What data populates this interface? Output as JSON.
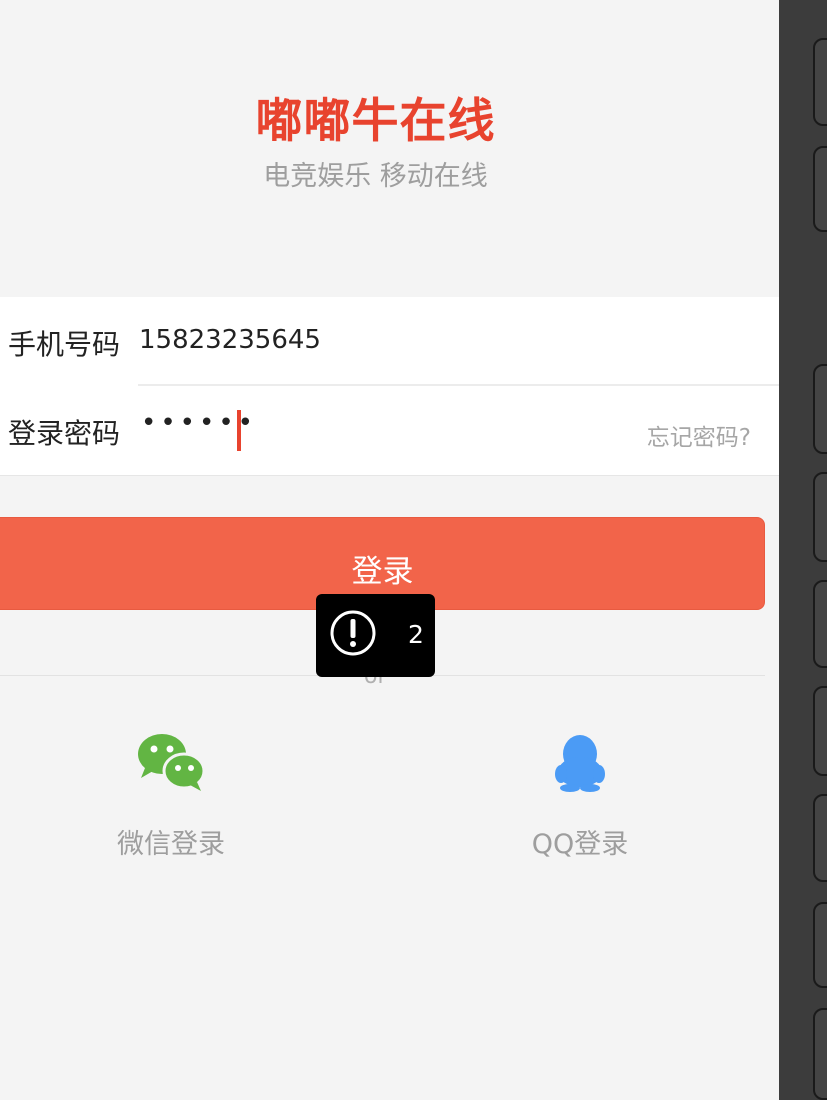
{
  "header": {
    "app_title": "嘟嘟牛在线",
    "tagline": "电竞娱乐 移动在线"
  },
  "form": {
    "phone_label": "手机号码",
    "phone_value": "15823235645",
    "password_label": "登录密码",
    "password_masked": "••••••",
    "forgot_label": "忘记密码?"
  },
  "actions": {
    "login_label": "登录",
    "or_text": "or"
  },
  "toast": {
    "icon": "alert-circle-icon",
    "count": "2"
  },
  "social": {
    "wechat_label": "微信登录",
    "wechat_icon": "wechat-icon",
    "qq_label": "QQ登录",
    "qq_icon": "qq-penguin-icon"
  },
  "colors": {
    "accent": "#e8432e",
    "button": "#f2644a",
    "wechat": "#62b543",
    "qq": "#4b9bf5"
  }
}
